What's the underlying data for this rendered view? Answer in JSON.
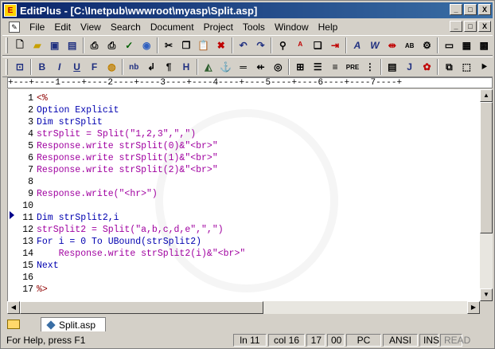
{
  "window": {
    "title": "EditPlus - [C:\\Inetpub\\wwwroot\\myasp\\Split.asp]",
    "controls": [
      "_",
      "□",
      "X"
    ],
    "doc_controls": [
      "_",
      "□",
      "X"
    ]
  },
  "menu": [
    "File",
    "Edit",
    "View",
    "Search",
    "Document",
    "Project",
    "Tools",
    "Window",
    "Help"
  ],
  "ruler": "+---+----1----+----2----+----3----+----4----+----5----+----6----+----7----+",
  "code": [
    {
      "n": "1",
      "t": "<%",
      "c": "pl"
    },
    {
      "n": "2",
      "t": "Option Explicit",
      "c": "kw"
    },
    {
      "n": "3",
      "t": "Dim strSplit",
      "c": "kw"
    },
    {
      "n": "4",
      "t": "strSplit = Split(\"1,2,3\",\",\")",
      "c": "mix1"
    },
    {
      "n": "5",
      "t": "Response.write strSplit(0)&\"<br>\"",
      "c": "mix2"
    },
    {
      "n": "6",
      "t": "Response.write strSplit(1)&\"<br>\"",
      "c": "mix2"
    },
    {
      "n": "7",
      "t": "Response.write strSplit(2)&\"<br>\"",
      "c": "mix2"
    },
    {
      "n": "8",
      "t": "",
      "c": "tx"
    },
    {
      "n": "9",
      "t": "Response.write(\"<hr>\")",
      "c": "mix3"
    },
    {
      "n": "10",
      "t": "",
      "c": "tx"
    },
    {
      "n": "11",
      "t": "Dim strSplit2,i",
      "c": "kw"
    },
    {
      "n": "12",
      "t": "strSplit2 = Split(\"a,b,c,d,e\",\",\")",
      "c": "mix1"
    },
    {
      "n": "13",
      "t": "For i = 0 To UBound(strSplit2)",
      "c": "mix4"
    },
    {
      "n": "14",
      "t": "    Response.write strSplit2(i)&\"<br>\"",
      "c": "mix2"
    },
    {
      "n": "15",
      "t": "Next",
      "c": "kw"
    },
    {
      "n": "16",
      "t": "",
      "c": "tx"
    },
    {
      "n": "17",
      "t": "%>",
      "c": "pl"
    }
  ],
  "tab": {
    "label": "Split.asp"
  },
  "status": {
    "help": "For Help, press F1",
    "line": "ln 11",
    "col": "col 16",
    "a": "17",
    "b": "00",
    "pc": "PC",
    "enc": "ANSI",
    "ins": "INS",
    "read": "READ"
  }
}
